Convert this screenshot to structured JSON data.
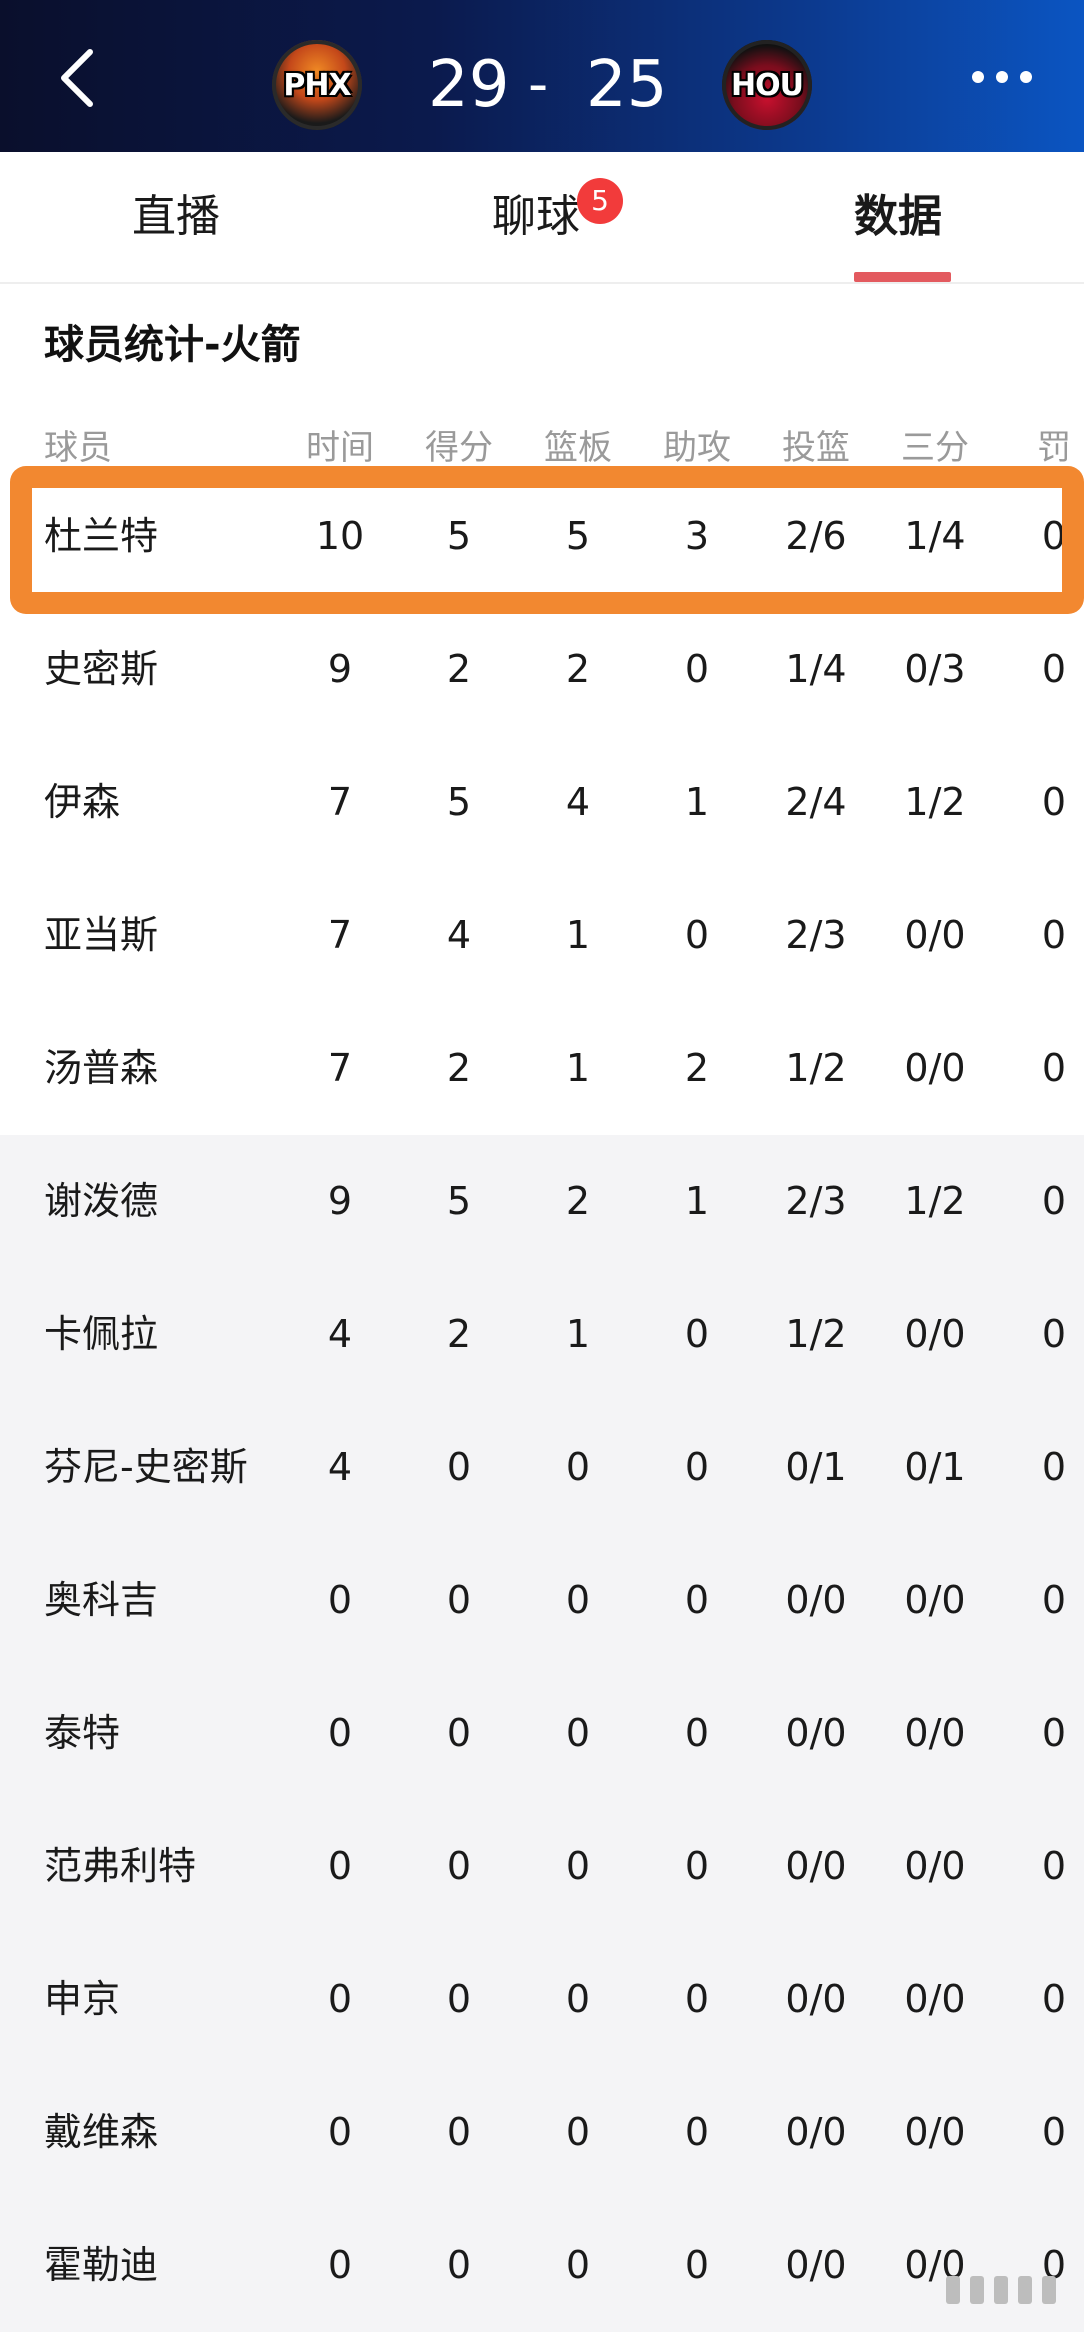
{
  "header": {
    "home_team": "PHX",
    "away_team": "HOU",
    "home_score": "29",
    "separator": "-",
    "away_score": "25"
  },
  "tabs": [
    {
      "label": "直播"
    },
    {
      "label": "聊球",
      "badge": "5"
    },
    {
      "label": "数据",
      "active": true
    }
  ],
  "section": {
    "title": "球员统计-火箭"
  },
  "table": {
    "columns": [
      "球员",
      "时间",
      "得分",
      "篮板",
      "助攻",
      "投篮",
      "三分",
      "罚"
    ],
    "rows": [
      [
        "杜兰特",
        "10",
        "5",
        "5",
        "3",
        "2/6",
        "1/4",
        "0"
      ],
      [
        "史密斯",
        "9",
        "2",
        "2",
        "0",
        "1/4",
        "0/3",
        "0"
      ],
      [
        "伊森",
        "7",
        "5",
        "4",
        "1",
        "2/4",
        "1/2",
        "0"
      ],
      [
        "亚当斯",
        "7",
        "4",
        "1",
        "0",
        "2/3",
        "0/0",
        "0"
      ],
      [
        "汤普森",
        "7",
        "2",
        "1",
        "2",
        "1/2",
        "0/0",
        "0"
      ],
      [
        "谢泼德",
        "9",
        "5",
        "2",
        "1",
        "2/3",
        "1/2",
        "0"
      ],
      [
        "卡佩拉",
        "4",
        "2",
        "1",
        "0",
        "1/2",
        "0/0",
        "0"
      ],
      [
        "芬尼-史密斯",
        "4",
        "0",
        "0",
        "0",
        "0/1",
        "0/1",
        "0"
      ],
      [
        "奥科吉",
        "0",
        "0",
        "0",
        "0",
        "0/0",
        "0/0",
        "0"
      ],
      [
        "泰特",
        "0",
        "0",
        "0",
        "0",
        "0/0",
        "0/0",
        "0"
      ],
      [
        "范弗利特",
        "0",
        "0",
        "0",
        "0",
        "0/0",
        "0/0",
        "0"
      ],
      [
        "申京",
        "0",
        "0",
        "0",
        "0",
        "0/0",
        "0/0",
        "0"
      ],
      [
        "戴维森",
        "0",
        "0",
        "0",
        "0",
        "0/0",
        "0/0",
        "0"
      ],
      [
        "霍勒迪",
        "0",
        "0",
        "0",
        "0",
        "0/0",
        "0/0",
        "0"
      ]
    ],
    "starters_count": 5,
    "highlighted_row": 0
  },
  "colors": {
    "accent": "#e35a5f",
    "highlight_border": "#f28830",
    "badge": "#f23b3b",
    "bench_bg": "#f4f4f6"
  },
  "icons": {
    "back": "chevron-left-icon",
    "more": "more-dots-icon"
  }
}
